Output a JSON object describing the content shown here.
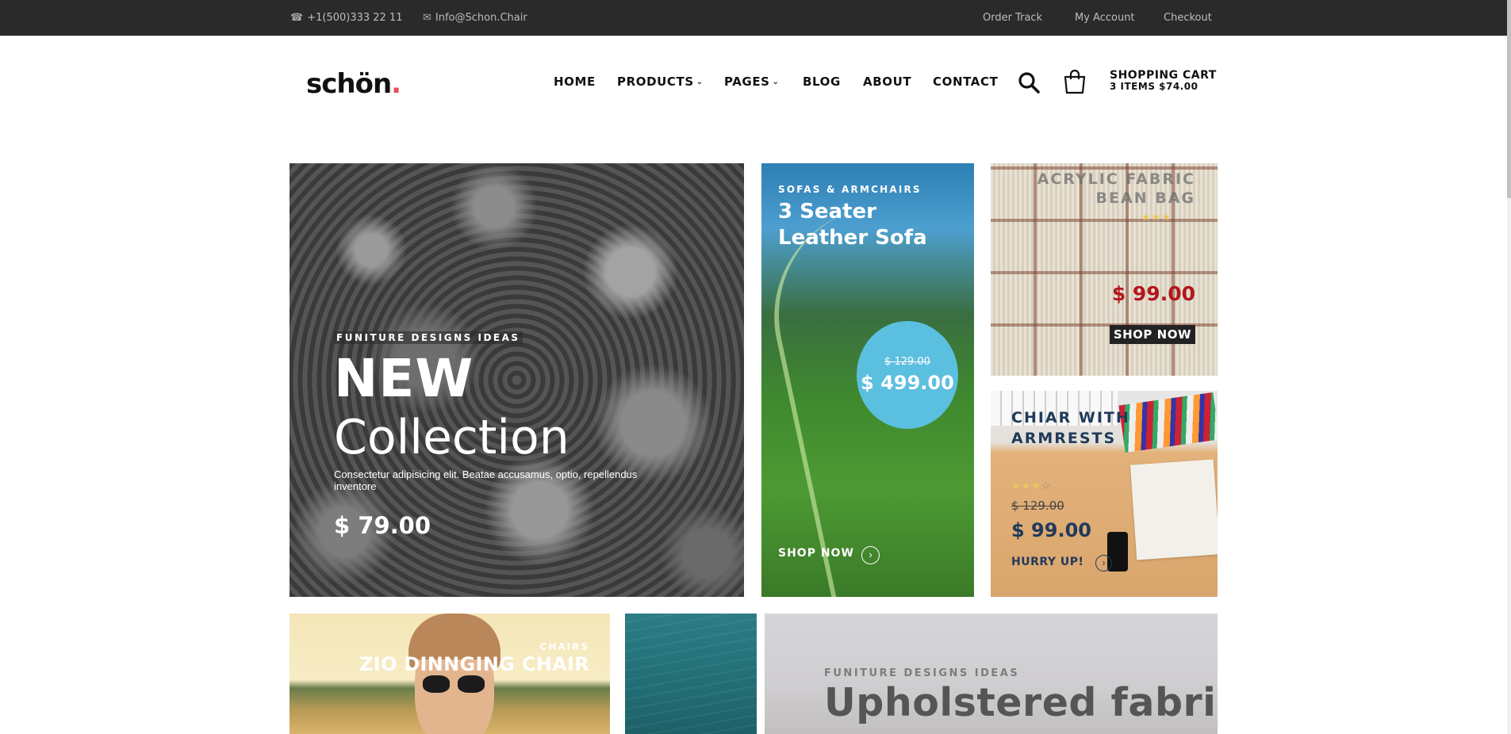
{
  "topbar": {
    "phone": "+1(500)333 22 11",
    "email": "Info@Schon.Chair",
    "links": [
      "Order Track",
      "My Account",
      "Checkout"
    ]
  },
  "header": {
    "logo_text": "schön",
    "logo_dot": ".",
    "nav": [
      "HOME",
      "PRODUCTS",
      "PAGES",
      "BLOG",
      "ABOUT",
      "CONTACT"
    ],
    "cart_title": "SHOPPING CART",
    "cart_summary": "3 ITEMS $74.00"
  },
  "hero": {
    "kicker": "FUNITURE DESIGNS IDEAS",
    "title_bold": "NEW",
    "title_light": "Collection",
    "description": "Consectetur adipisicing elit. Beatae accusamus, optio, repellendus inventore",
    "price": "$ 79.00"
  },
  "sofa": {
    "kicker": "SOFAS & ARMCHAIRS",
    "title": "3 Seater Leather Sofa",
    "old_price": "$ 129.00",
    "price": "$ 499.00",
    "cta": "SHOP NOW"
  },
  "bean_bag": {
    "title": "ACRYLIC FABRIC BEAN BAG",
    "rating": 3,
    "price": "$ 99.00",
    "cta": "SHOP NOW"
  },
  "armchair": {
    "title": "CHIAR WITH ARMRESTS",
    "rating": 3,
    "old_price": "$ 129.00",
    "price": "$ 99.00",
    "cta": "HURRY UP!"
  },
  "dining": {
    "kicker": "CHAIRS",
    "title": "ZIO DINNGING CHAIR"
  },
  "upholstered": {
    "kicker": "FUNITURE DESIGNS IDEAS",
    "title": "Upholstered fabric"
  },
  "colors": {
    "topbar_bg": "#2a2a2a",
    "logo_accent": "#e84d5a",
    "sale_badge": "#5bbfdf",
    "price_red": "#b2161b",
    "navy": "#203a5a"
  }
}
